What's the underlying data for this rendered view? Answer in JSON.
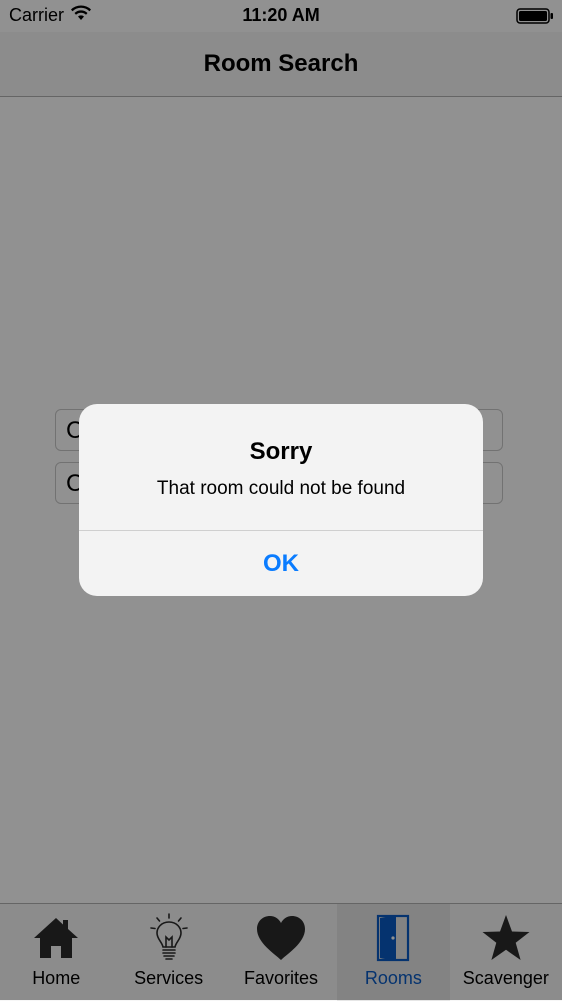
{
  "status_bar": {
    "carrier": "Carrier",
    "time": "11:20 AM"
  },
  "nav": {
    "title": "Room Search"
  },
  "fields": [
    {
      "value": "C"
    },
    {
      "value": "C"
    }
  ],
  "alert": {
    "title": "Sorry",
    "message": "That room could not be found",
    "ok_label": "OK"
  },
  "tabs": [
    {
      "label": "Home",
      "icon": "house-icon"
    },
    {
      "label": "Services",
      "icon": "lightbulb-icon"
    },
    {
      "label": "Favorites",
      "icon": "heart-icon"
    },
    {
      "label": "Rooms",
      "icon": "door-icon",
      "selected": true
    },
    {
      "label": "Scavenger",
      "icon": "star-icon"
    }
  ],
  "colors": {
    "accent": "#0a7cff",
    "selected_tab": "#0a5bc4",
    "overlay": "#000000"
  }
}
